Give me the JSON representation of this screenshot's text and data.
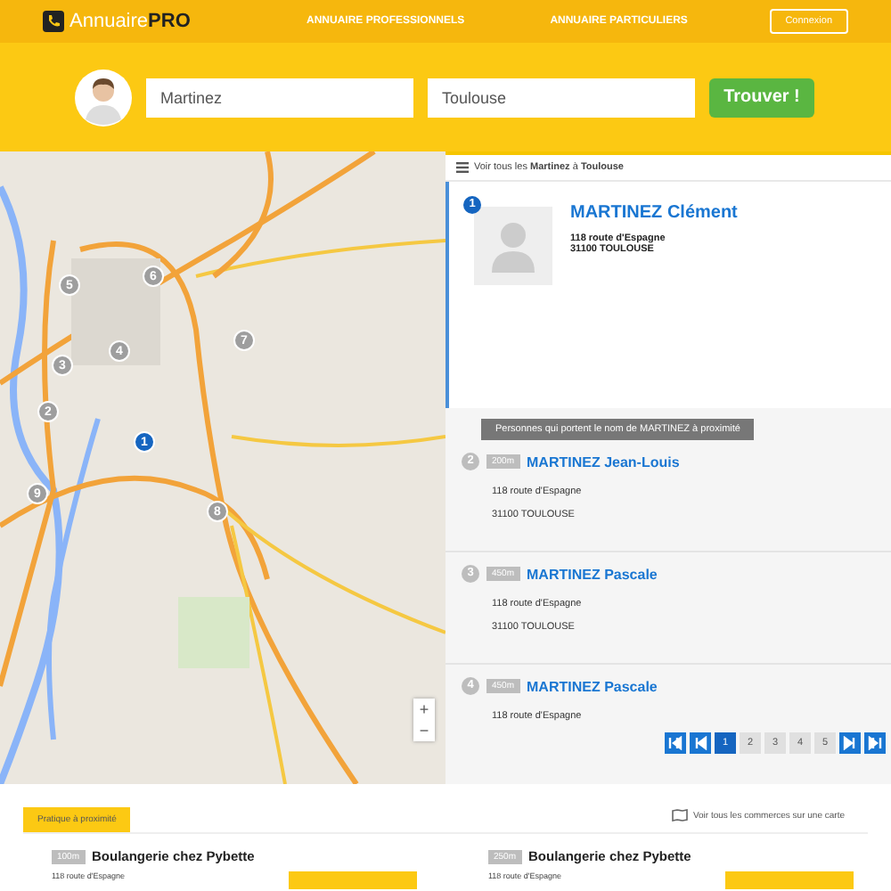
{
  "header": {
    "logo": "Annuaire**PRO**",
    "nav": [
      "ANNUAIRE PROFESSIONNELS",
      "ANNUAIRE PARTICULIERS"
    ],
    "login": "Connexion"
  },
  "search": {
    "name": "Martinez",
    "city": "Toulouse",
    "button": "Trouver !"
  },
  "map": {
    "markers": [
      {
        "label": "1",
        "selected": true
      },
      {
        "label": "2",
        "selected": false
      },
      {
        "label": "3",
        "selected": false
      },
      {
        "label": "4",
        "selected": false
      },
      {
        "label": "5",
        "selected": false
      },
      {
        "label": "6",
        "selected": false
      },
      {
        "label": "7",
        "selected": false
      },
      {
        "label": "8",
        "selected": false
      },
      {
        "label": "9",
        "selected": false
      }
    ],
    "zoom_in": "+",
    "zoom_out": "−"
  },
  "results": {
    "see_all": "Voir tous les **Martinez** à **Toulouse**",
    "main": {
      "number": "1",
      "name": "MARTINEZ Clément",
      "address": [
        "118 route d'Espagne",
        "31100 TOULOUSE"
      ]
    },
    "nearby_label": "Personnes qui portent le nom de MARTINEZ à proximité",
    "nearby": [
      {
        "number": "2",
        "distance": "200m",
        "name": "MARTINEZ Jean-Louis",
        "address": [
          "118 route d'Espagne",
          "31100 TOULOUSE"
        ]
      },
      {
        "number": "3",
        "distance": "450m",
        "name": "MARTINEZ Pascale",
        "address": [
          "118 route d'Espagne",
          "31100 TOULOUSE"
        ]
      },
      {
        "number": "4",
        "distance": "450m",
        "name": "MARTINEZ Pascale",
        "address": [
          "118 route d'Espagne"
        ]
      }
    ],
    "pagination": [
      {
        "kind": "first",
        "selected": false
      },
      {
        "kind": "prev",
        "selected": false
      },
      {
        "kind": "page",
        "label": "1",
        "selected": true
      },
      {
        "kind": "page",
        "label": "2",
        "selected": false
      },
      {
        "kind": "page",
        "label": "3",
        "selected": false
      },
      {
        "kind": "page",
        "label": "4",
        "selected": false
      },
      {
        "kind": "page",
        "label": "5",
        "selected": false
      },
      {
        "kind": "next",
        "selected": false
      },
      {
        "kind": "last",
        "selected": false
      }
    ]
  },
  "nearby_shops": {
    "tab": "Pratique à proximité",
    "map_link": "Voir tous les commerces sur une carte",
    "shops": [
      {
        "distance": "100m",
        "name": "Boulangerie chez Pybette",
        "address": "118 route d'Espagne"
      },
      {
        "distance": "250m",
        "name": "Boulangerie chez Pybette",
        "address": "118 route d'Espagne"
      }
    ]
  }
}
